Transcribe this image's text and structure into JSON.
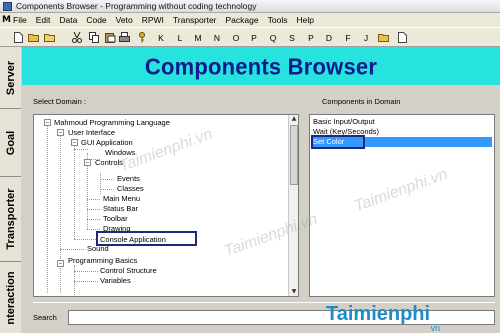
{
  "window": {
    "title": "Components Browser - Programming without coding technology"
  },
  "menubar": {
    "system_icon_text": "M",
    "items": [
      "File",
      "Edit",
      "Data",
      "Code",
      "Veto",
      "RPWI",
      "Transporter",
      "Package",
      "Tools",
      "Help"
    ]
  },
  "toolbar": {
    "letters": [
      "K",
      "L",
      "M",
      "N",
      "O",
      "P",
      "Q",
      "S",
      "P",
      "D",
      "F",
      "J"
    ]
  },
  "side_tabs": [
    "Server",
    "Goal",
    "Transporter",
    "nteraction"
  ],
  "banner": {
    "title": "Components Browser"
  },
  "domain_panel": {
    "label": "Select Domain :",
    "tree": [
      "Mahmoud Programming Language",
      "User Interface",
      "GUI Application",
      "Windows",
      "Controls",
      "Events",
      "Classes",
      "Main Menu",
      "Status Bar",
      "Toolbar",
      "Drawing",
      "Console Application",
      "Sound",
      "Programming Basics",
      "Control Structure",
      "Variables"
    ]
  },
  "components_panel": {
    "label": "Components in Domain",
    "items": [
      "Basic Input/Output",
      "Wait (Key/Seconds)",
      "Set Color"
    ],
    "selected_index": 2
  },
  "search": {
    "label": "Search",
    "value": ""
  },
  "watermark": {
    "text": "Taimienphi.vn",
    "logo": "Taimienphi",
    "logo_suffix": "vn"
  },
  "colors": {
    "banner_bg": "#27e3dd",
    "banner_text": "#0f1a8c",
    "selection": "#3399ff"
  }
}
